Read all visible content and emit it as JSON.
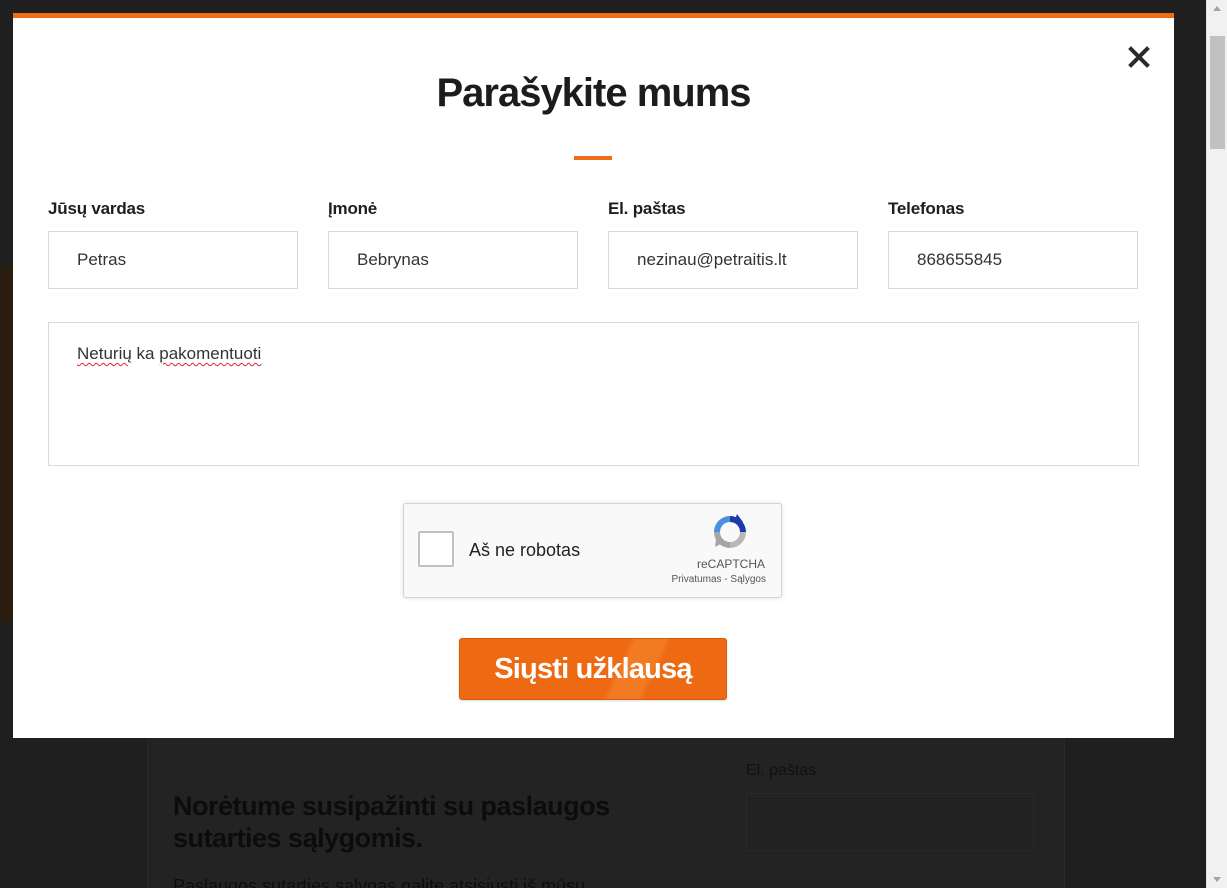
{
  "background": {
    "heading": "Norėtume susipažinti su paslaugos sutarties sąlygomis.",
    "paragraph": "Paslaugos sutarties sąlygas galite atsisiųsti iš mūsų",
    "email_label": "El. paštas"
  },
  "modal": {
    "title": "Parašykite mums",
    "accent_color": "#ef6d14",
    "close_icon": "close-icon",
    "fields": [
      {
        "label": "Jūsų vardas",
        "value": "Petras"
      },
      {
        "label": "Įmonė",
        "value": "Bebrynas"
      },
      {
        "label": "El. paštas",
        "value": "nezinau@petraitis.lt"
      },
      {
        "label": "Telefonas",
        "value": "868655845"
      }
    ],
    "comment": {
      "word1": "Neturių",
      "word2": "ka",
      "word3": "pakomentuoti"
    },
    "recaptcha": {
      "label": "Aš ne robotas",
      "brand": "reCAPTCHA",
      "privacy": "Privatumas",
      "separator": "-",
      "terms": "Sąlygos"
    },
    "submit_label": "Siųsti užklausą"
  }
}
